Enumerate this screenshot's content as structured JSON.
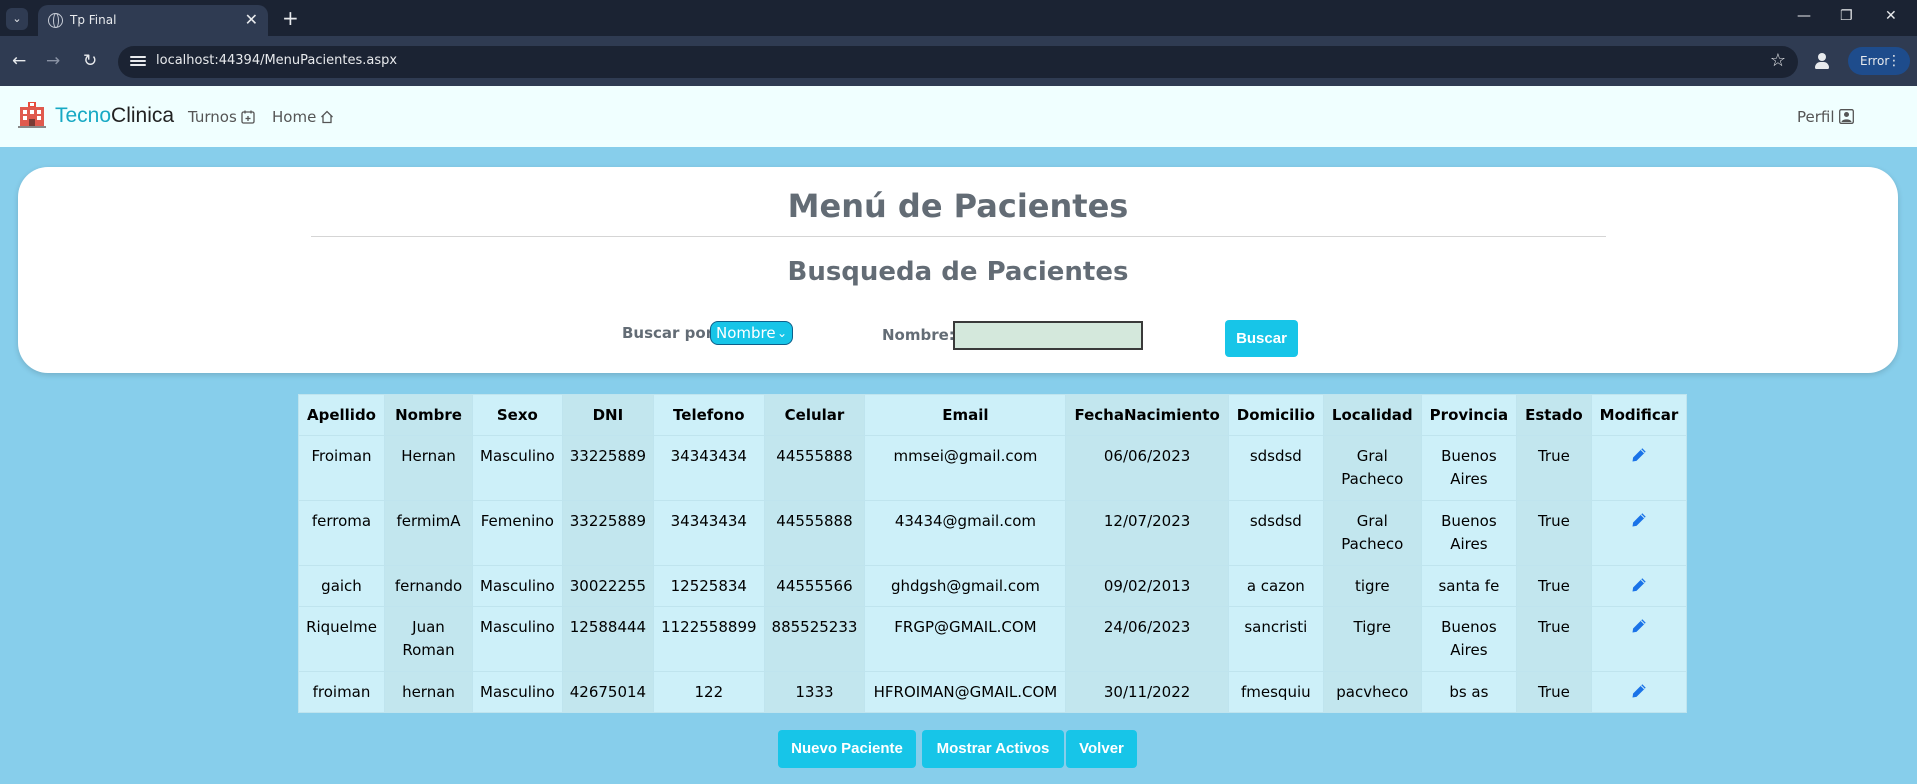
{
  "browser": {
    "tab_title": "Tp Final",
    "tab_close": "✕",
    "new_tab": "+",
    "url": "localhost:44394/MenuPacientes.aspx",
    "error_label": "Error",
    "window_controls": [
      "—",
      "❐",
      "✕"
    ]
  },
  "navbar": {
    "brand_part1": "Tecno",
    "brand_part2": "Clinica",
    "links": [
      "Turnos",
      "Home"
    ],
    "profile": "Perfil"
  },
  "page": {
    "title": "Menú de Pacientes",
    "subtitle": "Busqueda de Pacientes"
  },
  "search": {
    "buscar_por_label": "Buscar por:",
    "select_value": "Nombre",
    "field_label": "Nombre:",
    "input_value": "",
    "button": "Buscar"
  },
  "table": {
    "headers": [
      "Apellido",
      "Nombre",
      "Sexo",
      "DNI",
      "Telefono",
      "Celular",
      "Email",
      "FechaNacimiento",
      "Domicilio",
      "Localidad",
      "Provincia",
      "Estado",
      "Modificar"
    ],
    "rows": [
      [
        "Froiman",
        "Hernan",
        "Masculino",
        "33225889",
        "34343434",
        "44555888",
        "mmsei@gmail.com",
        "06/06/2023",
        "sdsdsd",
        "Gral Pacheco",
        "Buenos Aires",
        "True"
      ],
      [
        "ferroma",
        "fermimA",
        "Femenino",
        "33225889",
        "34343434",
        "44555888",
        "43434@gmail.com",
        "12/07/2023",
        "sdsdsd",
        "Gral Pacheco",
        "Buenos Aires",
        "True"
      ],
      [
        "gaich",
        "fernando",
        "Masculino",
        "30022255",
        "12525834",
        "44555566",
        "ghdgsh@gmail.com",
        "09/02/2013",
        "a cazon",
        "tigre",
        "santa fe",
        "True"
      ],
      [
        "Riquelme",
        "Juan Roman",
        "Masculino",
        "12588444",
        "1122558899",
        "885525233",
        "FRGP@GMAIL.COM",
        "24/06/2023",
        "sancristi",
        "Tigre",
        "Buenos Aires",
        "True"
      ],
      [
        "froiman",
        "hernan",
        "Masculino",
        "42675014",
        "122",
        "1333",
        "HFROIMAN@GMAIL.COM",
        "30/11/2022",
        "fmesquiu",
        "pacvheco",
        "bs as",
        "True"
      ]
    ]
  },
  "actions": {
    "nuevo": "Nuevo Paciente",
    "mostrar": "Mostrar Activos",
    "volver": "Volver"
  },
  "colors": {
    "page_bg": "#87CEEB",
    "accent": "#17C5E8",
    "navbar_bg": "#F0FFFF",
    "edit_icon": "#1A73E8"
  },
  "icons": {
    "brand": "hospital-icon",
    "turnos": "calendar-plus-icon",
    "home": "house-icon",
    "perfil": "person-square-icon",
    "modificar": "pencil-icon"
  }
}
